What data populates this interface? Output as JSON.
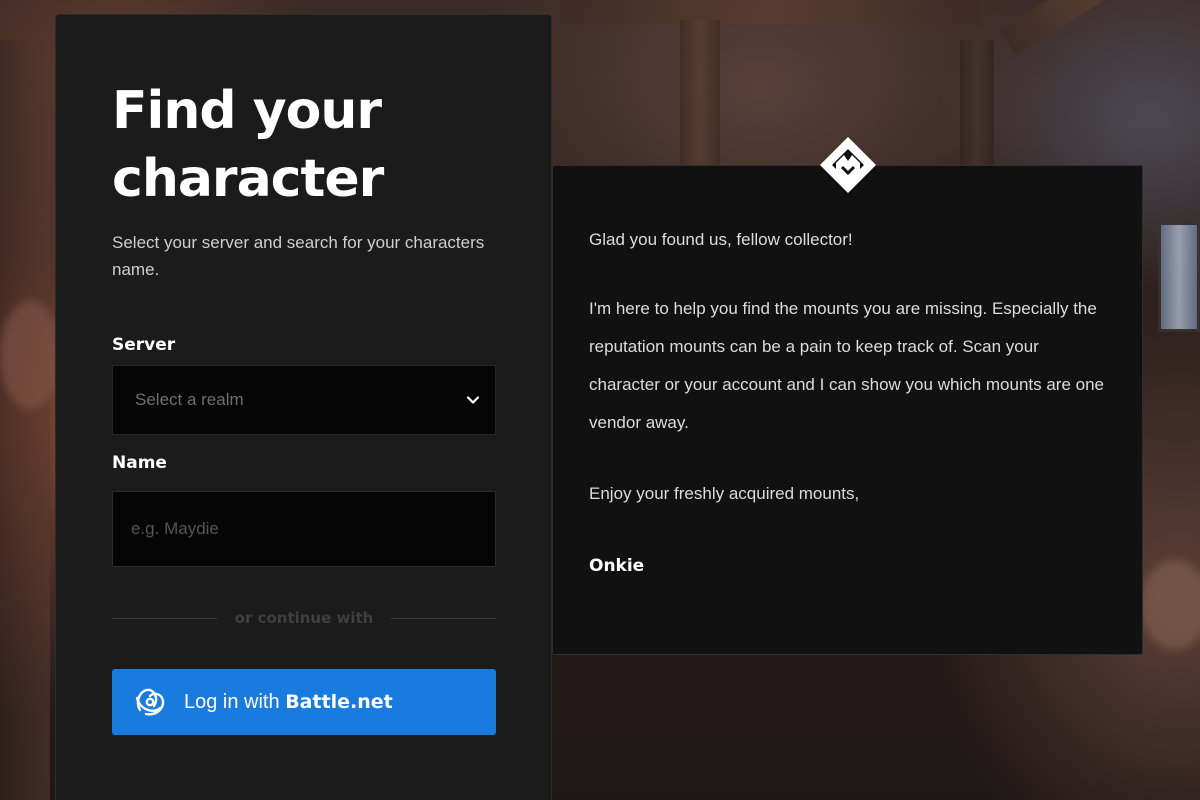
{
  "search_card": {
    "title": "Find your character",
    "subtitle": "Select your server and search for your characters name.",
    "server": {
      "label": "Server",
      "selected_value": "Select a realm"
    },
    "name": {
      "label": "Name",
      "placeholder": "e.g. Maydie",
      "value": ""
    },
    "divider_text": "or continue with",
    "battlenet_button": {
      "prefix": "Log in with",
      "brand": "Battle.net",
      "color": "#1a7bdf"
    }
  },
  "message_panel": {
    "logo_icon": "diamond-m-logo-icon",
    "greeting": "Glad you found us, fellow collector!",
    "body": "I'm here to help you find the mounts you are missing. Especially the reputation mounts can be a pain to keep track of. Scan your character or your account and I can show you which mounts are one vendor away.",
    "closing": "Enjoy your freshly acquired mounts,",
    "signature": "Onkie"
  },
  "colors": {
    "card_bg": "#1b1b1b",
    "panel_bg": "#111111",
    "input_bg": "#050505",
    "accent": "#1a7bdf"
  }
}
